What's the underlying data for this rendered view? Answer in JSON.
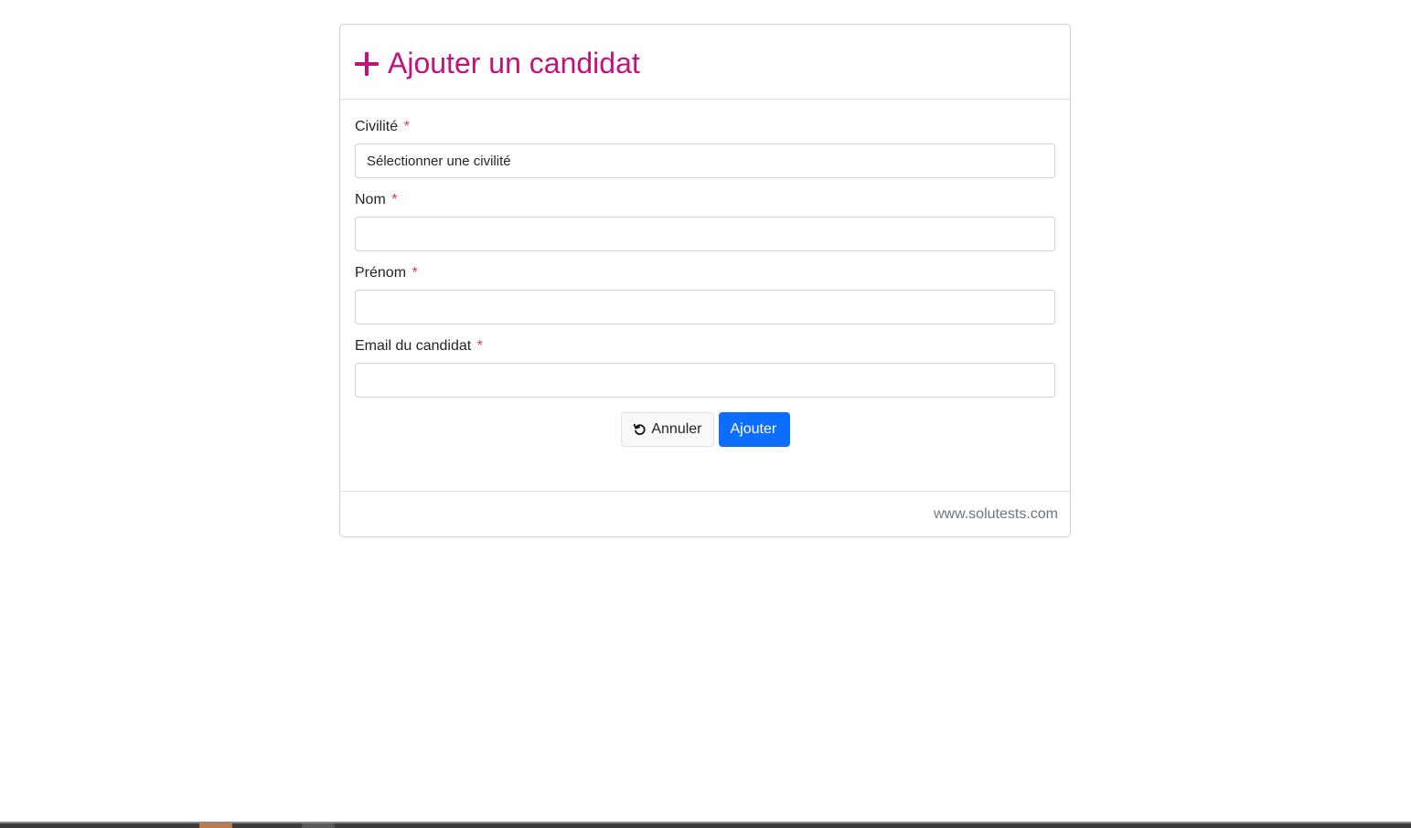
{
  "header": {
    "icon": "plus-icon",
    "title": "Ajouter un candidat"
  },
  "form": {
    "required_marker": "*",
    "civilite": {
      "label": "Civilité",
      "value": "Sélectionner une civilité"
    },
    "nom": {
      "label": "Nom",
      "value": ""
    },
    "prenom": {
      "label": "Prénom",
      "value": ""
    },
    "email": {
      "label": "Email du candidat",
      "value": ""
    }
  },
  "actions": {
    "cancel_icon": "undo-icon",
    "cancel_label": "Annuler",
    "submit_label": "Ajouter"
  },
  "footer": {
    "text": "www.solutests.com"
  },
  "colors": {
    "title": "#c2127c",
    "primary": "#0d6efd",
    "required": "#dc3545"
  }
}
